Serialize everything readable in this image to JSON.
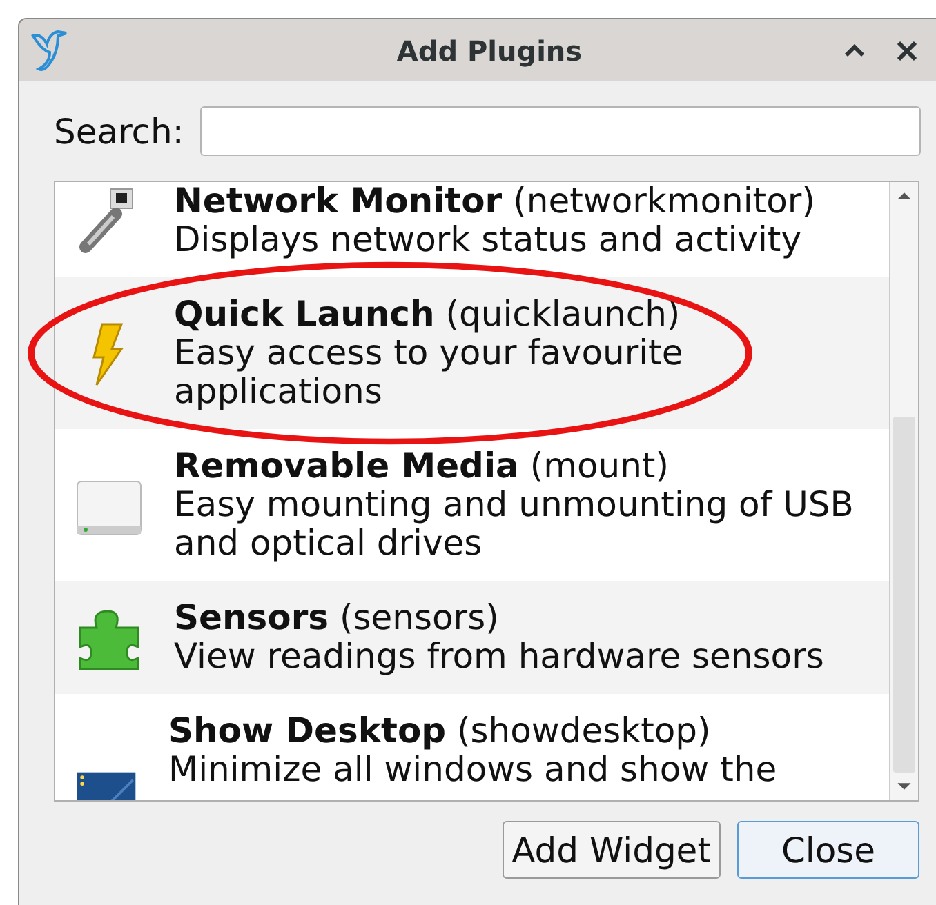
{
  "window": {
    "title": "Add Plugins"
  },
  "search": {
    "label": "Search:"
  },
  "plugins": [
    {
      "name": "Network Monitor",
      "id": "(networkmonitor)",
      "description": "Displays network status and activity",
      "circled": false
    },
    {
      "name": "Quick Launch",
      "id": "(quicklaunch)",
      "description": "Easy access to your favourite applications",
      "circled": true
    },
    {
      "name": "Removable Media",
      "id": "(mount)",
      "description": "Easy mounting and unmounting of USB and optical drives",
      "circled": false
    },
    {
      "name": "Sensors",
      "id": "(sensors)",
      "description": "View readings from hardware sensors",
      "circled": false
    },
    {
      "name": "Show Desktop",
      "id": "(showdesktop)",
      "description": "Minimize all windows and show the",
      "circled": false
    }
  ],
  "buttons": [
    {
      "label": "Add Widget",
      "kind": "plain"
    },
    {
      "label": "Close",
      "kind": "default"
    }
  ]
}
